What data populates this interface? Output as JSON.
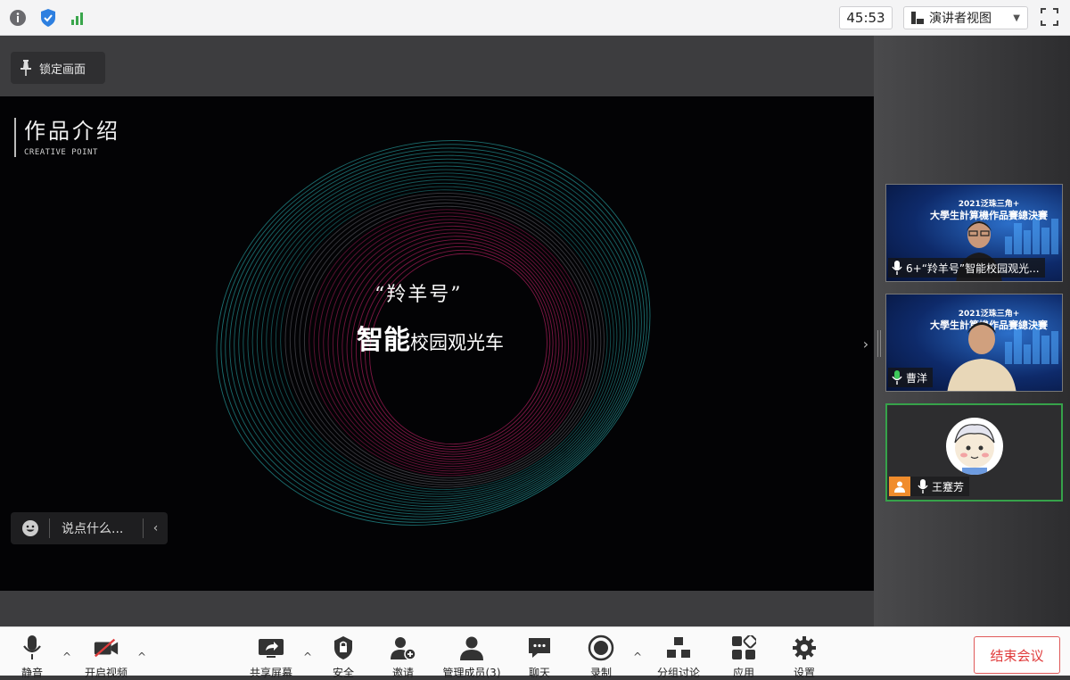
{
  "topbar": {
    "timer": "45:53",
    "view_mode": "演讲者视图",
    "icons": [
      "info-icon",
      "shield-icon",
      "signal-icon",
      "fullscreen-icon"
    ]
  },
  "stage": {
    "lock_label": "锁定画面",
    "slide": {
      "title": "作品介绍",
      "subtitle": "CREATIVE POINT",
      "quote": "“羚羊号”",
      "main_big": "智能",
      "main_small": "校园观光车"
    },
    "chat_placeholder": "说点什么..."
  },
  "participants": [
    {
      "name": "6+“羚羊号”智能校园观光...",
      "mic": "mic-icon",
      "banner_year": "2021泛珠三角+",
      "banner_title": "大學生計算機作品賽總決賽"
    },
    {
      "name": "曹洋",
      "mic": "mic-active-icon",
      "banner_year": "2021泛珠三角+",
      "banner_title": "大學生計算機作品賽總決賽"
    },
    {
      "name": "王蹇芳",
      "mic": "mic-icon"
    }
  ],
  "toolbar": {
    "mute": "静音",
    "video": "开启视频",
    "share": "共享屏幕",
    "security": "安全",
    "invite": "邀请",
    "members": "管理成员(3)",
    "chat": "聊天",
    "record": "录制",
    "breakout": "分组讨论",
    "apps": "应用",
    "settings": "设置",
    "end": "结束会议"
  },
  "colors": {
    "ring_cyan": "#2fc8c8",
    "ring_magenta": "#e8287a",
    "end_red": "#e03c3c",
    "active_green": "#36a24a"
  }
}
